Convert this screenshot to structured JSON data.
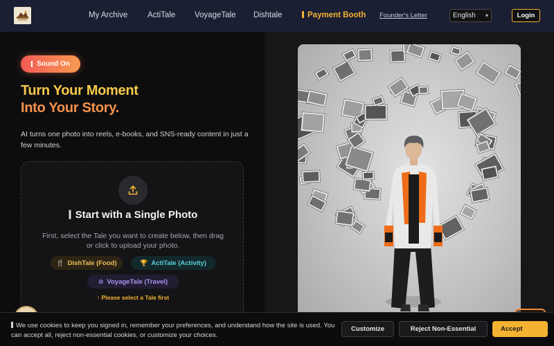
{
  "nav": {
    "links": [
      "My Archive",
      "ActiTale",
      "VoyageTale",
      "Dishtale"
    ],
    "active_link": "Payment Booth",
    "founders_letter": "Founder's Letter",
    "language": "English",
    "login": "Login"
  },
  "hero": {
    "sound_label": "Sound On",
    "headline_line1": "Turn Your Moment",
    "headline_line2": "Into Your Story.",
    "subtext": "AI turns one photo into reels, e-books, and SNS-ready content in just a few minutes."
  },
  "upload_card": {
    "title": "Start with a Single Photo",
    "description": "First, select the Tale you want to create below, then drag or click to upload your photo.",
    "chips": {
      "dish": "DishTale (Food)",
      "acti": "ActiTale (Activity)",
      "voyage": "VoyageTale (Travel)"
    },
    "hint": "↑ Please select a Tale first"
  },
  "cookie": {
    "text": "We use cookies to keep you signed in, remember your preferences, and understand how the site is used. You can accept all, reject non-essential cookies, or customize your choices.",
    "customize": "Customize",
    "reject": "Reject Non-Essential",
    "accept": "Accept"
  },
  "colors": {
    "accent": "#f5b332",
    "headline_yellow": "#f7c94a",
    "headline_orange": "#f7924a",
    "nav_bg": "#1a1f33"
  },
  "icons": [
    "logo-icon",
    "upload-icon",
    "fork-knife-icon",
    "trophy-icon",
    "compass-icon",
    "chevron-down-icon",
    "chat-bot-icon"
  ]
}
